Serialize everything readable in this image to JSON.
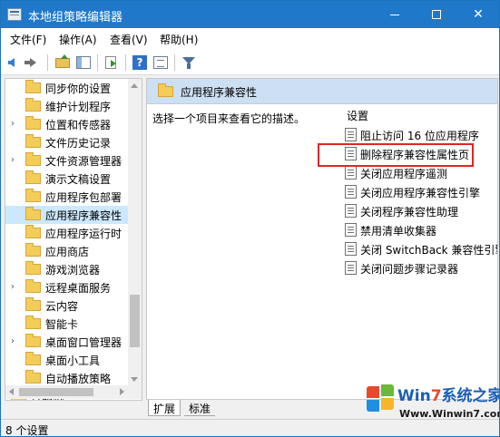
{
  "window": {
    "title": "本地组策略编辑器"
  },
  "titlebar": {
    "minimize_glyph": "",
    "maximize_glyph": "",
    "close_glyph": "✕"
  },
  "menu": {
    "items": [
      "文件(F)",
      "操作(A)",
      "查看(V)",
      "帮助(H)"
    ]
  },
  "toolbar": {
    "icons": [
      "back-arrow-icon",
      "forward-arrow-icon",
      "folder-up-icon",
      "show-hide-tree-icon",
      "export-list-icon",
      "help-icon",
      "properties-icon",
      "filter-icon"
    ],
    "help_glyph": "?"
  },
  "tree": {
    "items": [
      {
        "label": "同步你的设置",
        "has_children": false
      },
      {
        "label": "维护计划程序",
        "has_children": false
      },
      {
        "label": "位置和传感器",
        "has_children": true
      },
      {
        "label": "文件历史记录",
        "has_children": false
      },
      {
        "label": "文件资源管理器",
        "has_children": true
      },
      {
        "label": "演示文稿设置",
        "has_children": false
      },
      {
        "label": "应用程序包部署",
        "has_children": false
      },
      {
        "label": "应用程序兼容性",
        "has_children": false,
        "selected": true
      },
      {
        "label": "应用程序运行时",
        "has_children": false
      },
      {
        "label": "应用商店",
        "has_children": false
      },
      {
        "label": "游戏浏览器",
        "has_children": false
      },
      {
        "label": "远程桌面服务",
        "has_children": true
      },
      {
        "label": "云内容",
        "has_children": false
      },
      {
        "label": "智能卡",
        "has_children": false
      },
      {
        "label": "桌面窗口管理器",
        "has_children": true
      },
      {
        "label": "桌面小工具",
        "has_children": false
      },
      {
        "label": "自动播放策略",
        "has_children": false
      },
      {
        "label": "打印机",
        "has_children": false
      }
    ],
    "expand_glyph": "›"
  },
  "right_pane": {
    "header_title": "应用程序兼容性",
    "description_prompt": "选择一个项目来查看它的描述。",
    "column_header": "设置",
    "settings": [
      "阻止访问 16 位应用程序",
      "删除程序兼容性属性页",
      "关闭应用程序遥测",
      "关闭应用程序兼容性引擎",
      "关闭程序兼容性助理",
      "禁用清单收集器",
      "关闭 SwitchBack 兼容性引擎",
      "关闭问题步骤记录器"
    ],
    "highlighted_index": 1,
    "highlight_color": "#e02525"
  },
  "tabs": {
    "items": [
      "扩展",
      "标准"
    ],
    "active_index": 0
  },
  "status": {
    "text": "8 个设置"
  },
  "watermark": {
    "brand_prefix": "Win",
    "brand_seven": "7",
    "brand_suffix": "系统之家",
    "url": "Www.Winwin7.com"
  },
  "colors": {
    "titlebar": "#1f78c9",
    "selection": "#cce8ff",
    "header_band": "#cddff2",
    "folder": "#f3cc5a"
  }
}
